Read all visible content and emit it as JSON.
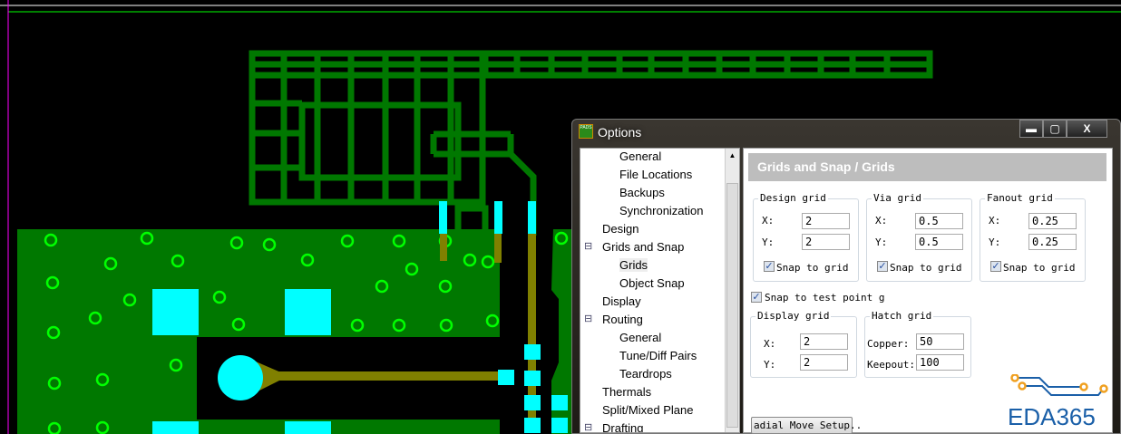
{
  "dialog": {
    "title": "Options",
    "minimize": "▬",
    "maximize": "▢",
    "close": "X",
    "app_icon": "PADS"
  },
  "tree": {
    "items": [
      {
        "label": "General",
        "level": 2
      },
      {
        "label": "File Locations",
        "level": 2
      },
      {
        "label": "Backups",
        "level": 2
      },
      {
        "label": "Synchronization",
        "level": 2
      },
      {
        "label": "Design",
        "level": 1
      },
      {
        "label": "Grids and Snap",
        "level": 1,
        "expanded": true
      },
      {
        "label": "Grids",
        "level": 2,
        "selected": true
      },
      {
        "label": "Object Snap",
        "level": 2
      },
      {
        "label": "Display",
        "level": 1
      },
      {
        "label": "Routing",
        "level": 1,
        "expanded": true
      },
      {
        "label": "General",
        "level": 2
      },
      {
        "label": "Tune/Diff Pairs",
        "level": 2
      },
      {
        "label": "Teardrops",
        "level": 2
      },
      {
        "label": "Thermals",
        "level": 1
      },
      {
        "label": "Split/Mixed Plane",
        "level": 1
      },
      {
        "label": "Drafting",
        "level": 1,
        "expanded": true
      }
    ]
  },
  "panel": {
    "header": "Grids and Snap / Grids",
    "design_grid": {
      "legend": "Design grid",
      "x_label": "X:",
      "y_label": "Y:",
      "x": "2",
      "y": "2",
      "snap_label": "Snap to grid",
      "snap": true
    },
    "via_grid": {
      "legend": "Via grid",
      "x_label": "X:",
      "y_label": "Y:",
      "x": "0.5",
      "y": "0.5",
      "snap_label": "Snap to grid",
      "snap": true
    },
    "fanout_grid": {
      "legend": "Fanout grid",
      "x_label": "X:",
      "y_label": "Y:",
      "x": "0.25",
      "y": "0.25",
      "snap_label": "Snap to grid",
      "snap": true
    },
    "snap_test_point_label": "Snap to test point g",
    "snap_test_point": true,
    "display_grid": {
      "legend": "Display grid",
      "x_label": "X:",
      "y_label": "Y:",
      "x": "2",
      "y": "2"
    },
    "hatch_grid": {
      "legend": "Hatch grid",
      "copper_label": "Copper:",
      "keepout_label": "Keepout:",
      "copper": "50",
      "keepout": "100"
    },
    "radial_button": "adial Move Setup.."
  },
  "watermark": "EDA365",
  "colors": {
    "copper": "#007800",
    "via": "#00ff00",
    "pad": "#00ffff",
    "trace": "#808000",
    "logo": "#1a5fa8",
    "logo_dot": "#f0a020"
  }
}
